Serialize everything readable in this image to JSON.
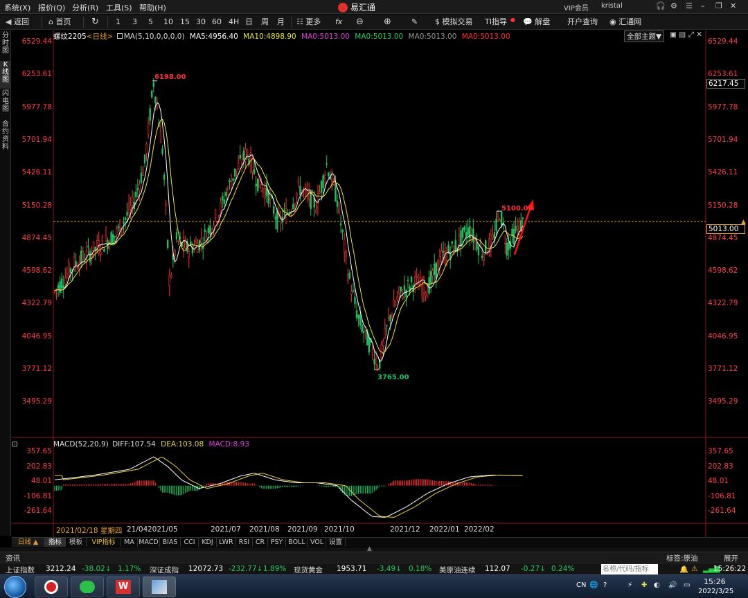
{
  "menubar": {
    "items": [
      "系统(X)",
      "报价(Q)",
      "分析(R)",
      "工具(S)",
      "帮助(H)"
    ],
    "app_title": "易汇通",
    "vip": "VIP会员",
    "user": "kristal"
  },
  "toolbar": {
    "back": "返回",
    "home": "首页",
    "periods": [
      "1",
      "3",
      "5",
      "10",
      "15",
      "30",
      "60",
      "4H",
      "日",
      "周",
      "月"
    ],
    "more": "更多",
    "fx": "fx",
    "sim_trade": "模拟交易",
    "ti": "TI指导",
    "decode": "解盘",
    "open_account": "开户查询",
    "huitong": "汇通网"
  },
  "left_tabs": [
    "分时图",
    "K线图",
    "闪电图",
    "合约资料"
  ],
  "chart_header": {
    "symbol": "螺纹2205",
    "period": "<日线>",
    "ma_params": "MA(5,10,0,0,0,0)",
    "ma5": "MA5:4956.40",
    "ma10": "MA10:4898.90",
    "ma0a": "MA0:5013.00",
    "ma0b": "MA0:5013.00",
    "ma0c": "MA0:5013.00",
    "ma0d": "MA0:5013.00",
    "theme": "全部主题▼"
  },
  "price_axis": [
    "6529.44",
    "6253.61",
    "5977.78",
    "5701.94",
    "5426.11",
    "5150.28",
    "4874.45",
    "4598.62",
    "4322.79",
    "4046.95",
    "3771.12",
    "3495.29"
  ],
  "price_tags": {
    "top_right": "6217.45",
    "current": "5013.00",
    "high": "6198.00",
    "low": "3765.00",
    "recent_high": "5100.00"
  },
  "macd_header": {
    "params": "MACD(52,20,9)",
    "diff": "DIFF:107.54",
    "dea": "DEA:103.08",
    "macd": "MACD:8.93"
  },
  "macd_axis": [
    "357.65",
    "202.83",
    "48.01",
    "-106.81",
    "-261.64"
  ],
  "date_axis": {
    "cursor": "2021/02/18 星期四",
    "labels": [
      "21/04",
      "2021/05",
      "2021/07",
      "2021/08",
      "2021/09",
      "2021/10",
      "2021/12",
      "2022/01",
      "2022/02"
    ]
  },
  "indicator_tabs": [
    "日线 ▲",
    "指标",
    "模板",
    "VIP指标",
    "MA",
    "MACD",
    "BIAS",
    "CCI",
    "KDJ",
    "LWR",
    "RSI",
    "CR",
    "PSY",
    "BOLL",
    "VOL",
    "设置"
  ],
  "news": {
    "label": "资讯",
    "tag": "标签:原油",
    "expand": "展开"
  },
  "ticker": [
    {
      "name": "上证指数",
      "value": "3212.24",
      "change": "-38.02↓",
      "pct": "1.17%"
    },
    {
      "name": "深证成指",
      "value": "12072.73",
      "change": "-232.77↓",
      "pct": "1.89%"
    },
    {
      "name": "现货黄金",
      "value": "1953.71",
      "change": "-3.49↓",
      "pct": "0.18%"
    },
    {
      "name": "美原油连续",
      "value": "112.07",
      "change": "-0.27↓",
      "pct": "0.24%"
    }
  ],
  "search_placeholder": "名称/代码/指标",
  "taskbar": {
    "lang": "CN",
    "time": "15:26",
    "date": "2022/3/25",
    "clock_status": "15:26:22"
  },
  "colors": {
    "up": "#ff3030",
    "down": "#20c060",
    "ma5": "#ffffff",
    "ma10": "#e8e840",
    "macd_dea": "#e8d040",
    "accent": "#ff4040"
  }
}
